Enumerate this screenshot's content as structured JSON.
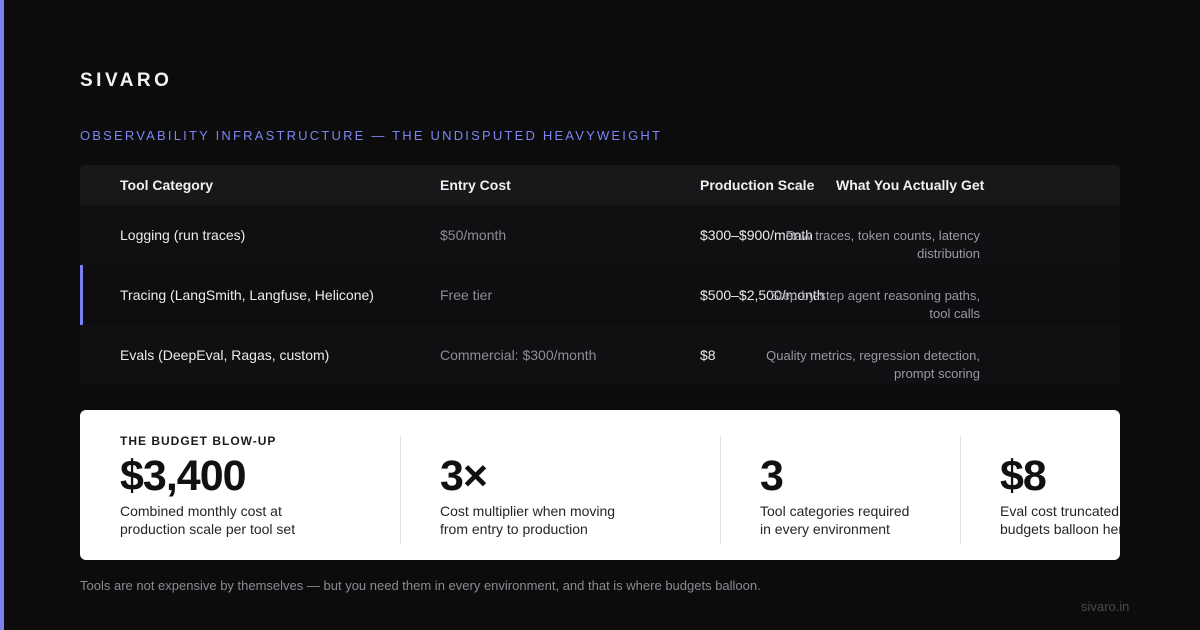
{
  "brand": "SIVARO",
  "eyebrow": "OBSERVABILITY INFRASTRUCTURE — THE UNDISPUTED HEAVYWEIGHT",
  "table": {
    "headers": [
      "Tool Category",
      "Entry Cost",
      "Production Scale",
      "What You Actually Get"
    ],
    "rows": [
      {
        "category": "Logging (run traces)",
        "entry": "$50/month",
        "production": "$300–$900/month",
        "get": "Raw traces, token counts, latency distribution"
      },
      {
        "category": "Tracing (LangSmith, Langfuse, Helicone)",
        "entry": "Free tier",
        "production": "$500–$2,500/month",
        "get": "Step-by-step agent reasoning paths, tool calls"
      },
      {
        "category": "Evals (DeepEval, Ragas, custom)",
        "entry": "Commercial: $300/month",
        "production": "$8",
        "get": "Quality metrics, regression detection, prompt scoring"
      }
    ]
  },
  "stats": {
    "kicker": "THE BUDGET BLOW-UP",
    "items": [
      {
        "value": "$3,400",
        "desc": "Combined monthly cost at production scale per tool set"
      },
      {
        "value": "3×",
        "desc": "Cost multiplier when moving from entry to production"
      },
      {
        "value": "3",
        "desc": "Tool categories required in every environment"
      },
      {
        "value": "$8",
        "desc": "Eval cost truncated — budgets balloon here"
      }
    ]
  },
  "footnote": "Tools are not expensive by themselves — but you need them in every environment, and that is where budgets balloon.",
  "site": "sivaro.in",
  "colors": {
    "accent": "#7b7ff0",
    "background": "#0c0c0d",
    "card": "#ffffff"
  }
}
